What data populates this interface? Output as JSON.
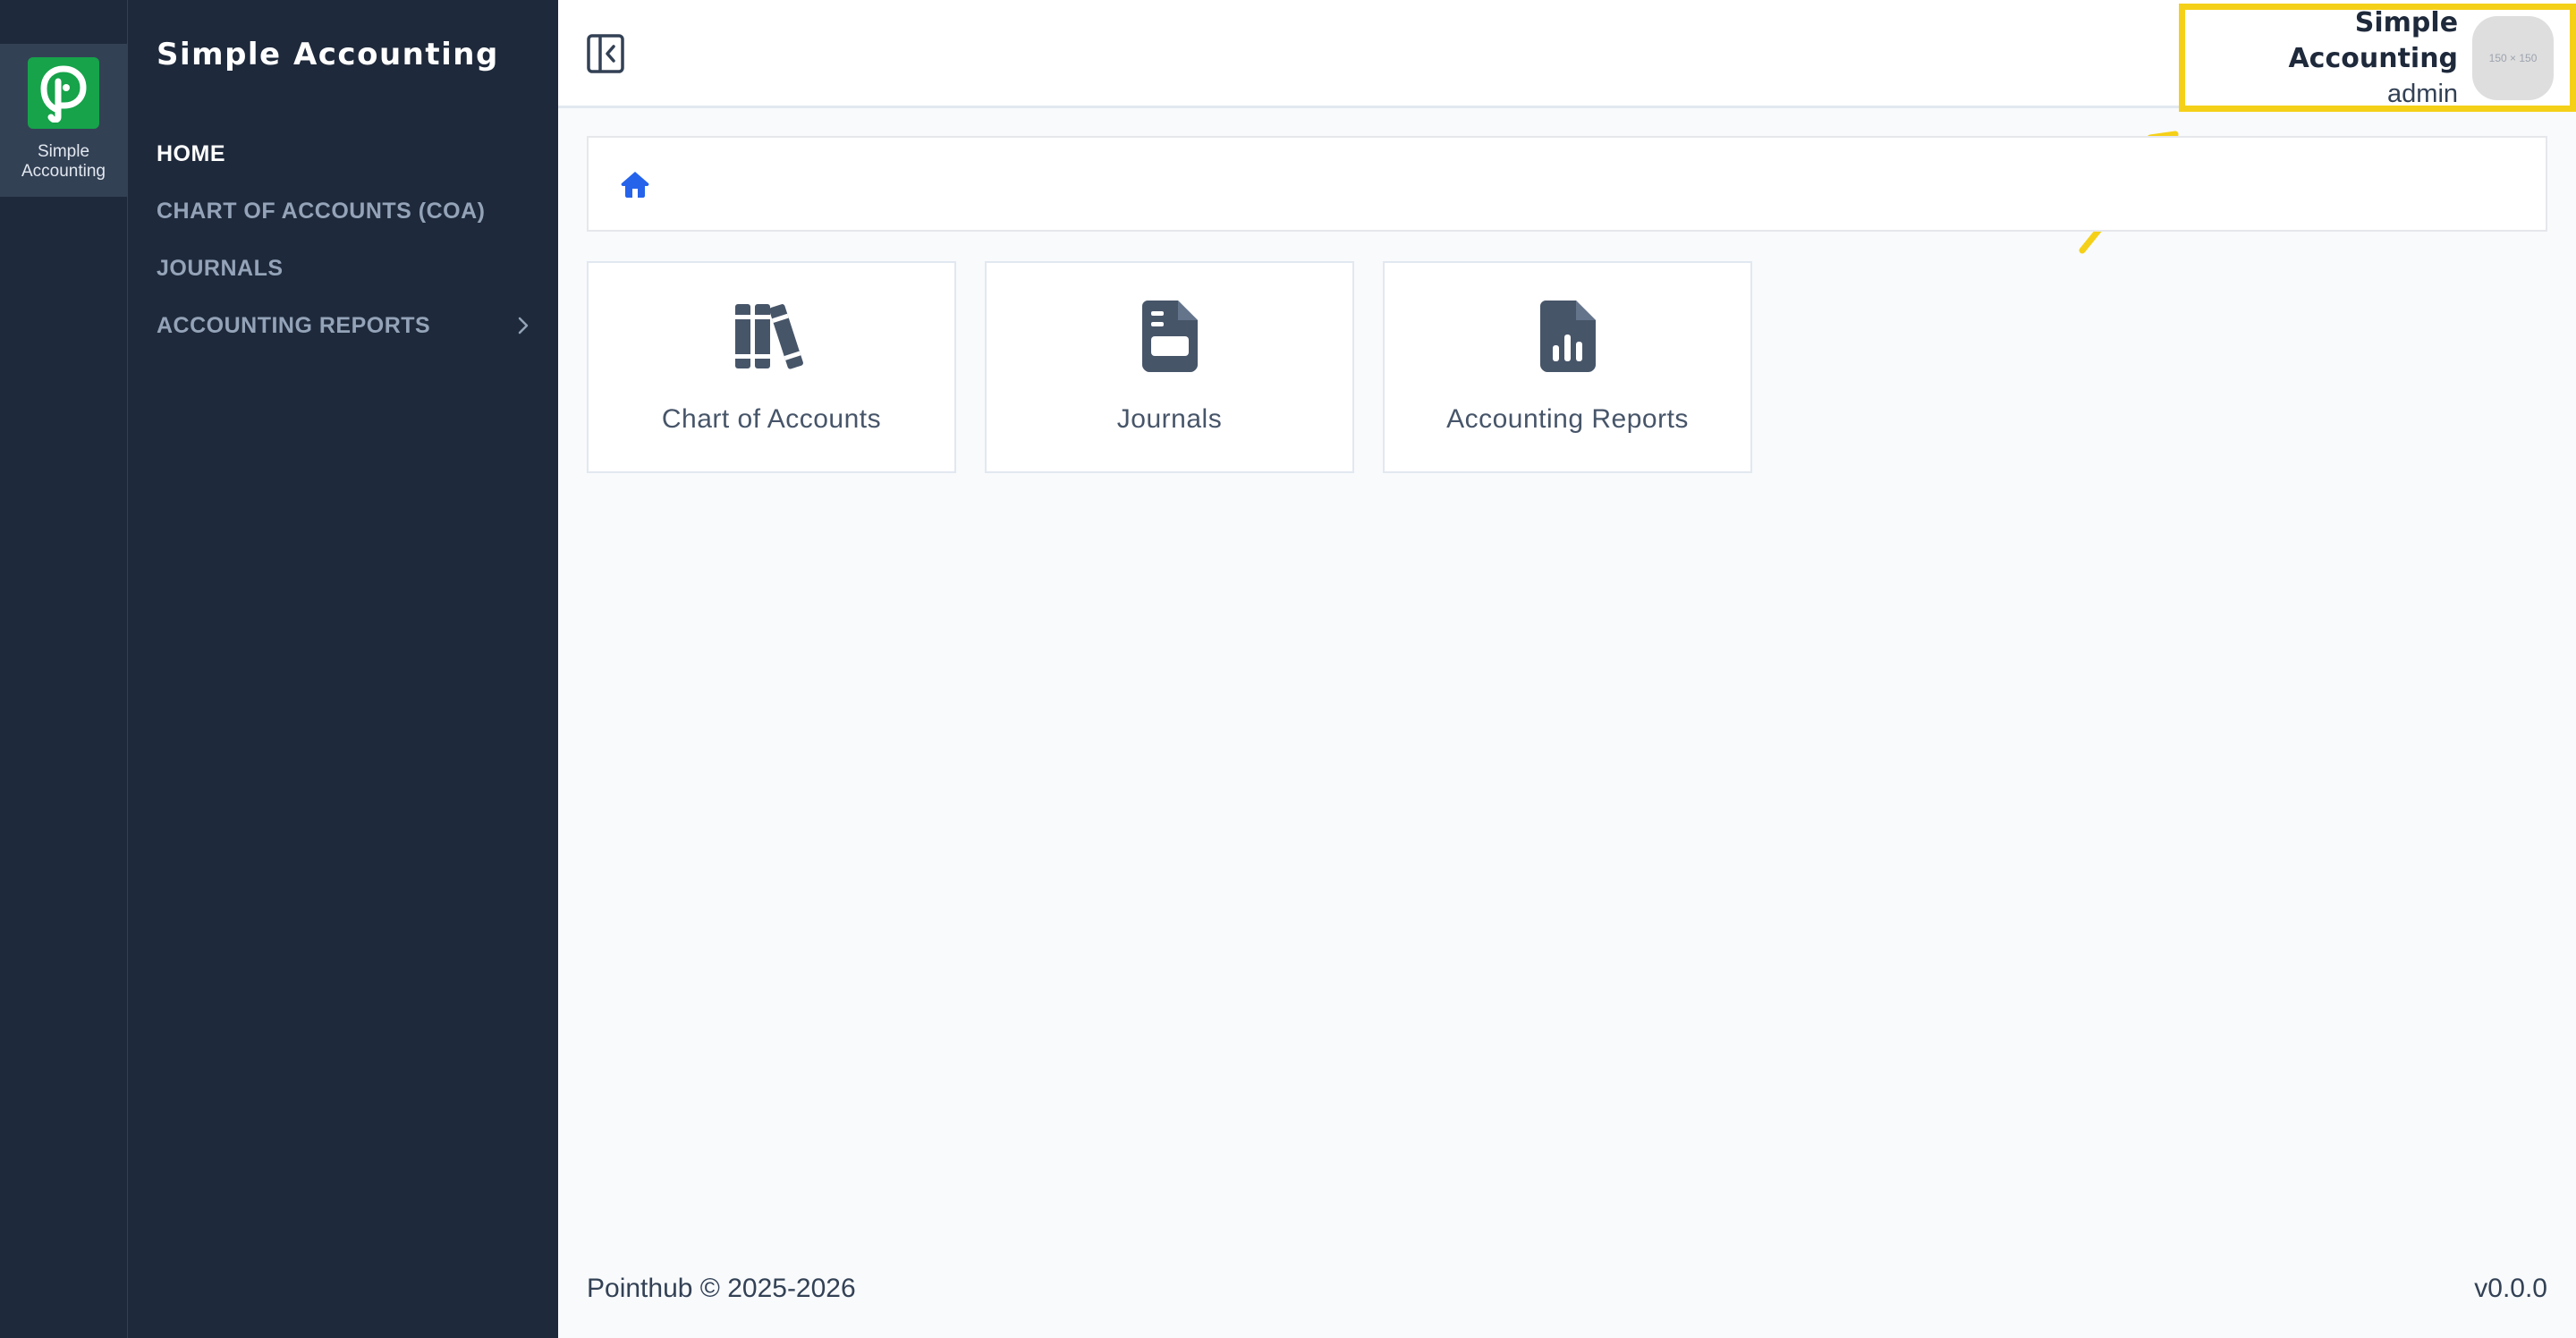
{
  "rail": {
    "app_label": "Simple Accounting"
  },
  "sidebar": {
    "title": "Simple Accounting",
    "items": [
      {
        "label": "HOME"
      },
      {
        "label": "CHART OF ACCOUNTS (COA)"
      },
      {
        "label": "JOURNALS"
      },
      {
        "label": "ACCOUNTING REPORTS"
      }
    ]
  },
  "header": {
    "user_name": "Simple Accounting",
    "user_role": "admin",
    "avatar_text": "150 × 150"
  },
  "cards": [
    {
      "label": "Chart of Accounts",
      "icon": "books-icon"
    },
    {
      "label": "Journals",
      "icon": "journal-file-icon"
    },
    {
      "label": "Accounting Reports",
      "icon": "report-chart-file-icon"
    }
  ],
  "footer": {
    "copyright": "Pointhub © 2025-2026",
    "version": "v0.0.0"
  },
  "colors": {
    "sidebar_bg": "#1e293b",
    "logo_green": "#16a34a",
    "highlight_yellow": "#f5d018",
    "home_icon_blue": "#2563eb",
    "card_icon": "#475569"
  }
}
